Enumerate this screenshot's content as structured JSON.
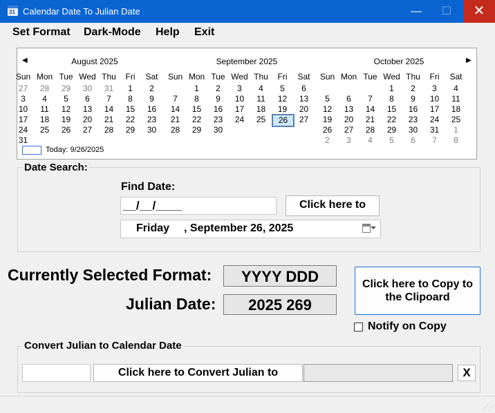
{
  "window": {
    "title": "Calendar Date To Julian Date",
    "minimize": "—",
    "maximize": "☐",
    "close": "✕"
  },
  "menu": [
    "Set Format",
    "Dark-Mode",
    "Help",
    "Exit"
  ],
  "calendar": {
    "prev": "◀",
    "next": "▶",
    "dow": [
      "Sun",
      "Mon",
      "Tue",
      "Wed",
      "Thu",
      "Fri",
      "Sat"
    ],
    "months": [
      {
        "title": "August 2025",
        "rows": [
          [
            [
              "27",
              1
            ],
            [
              "28",
              1
            ],
            [
              "29",
              1
            ],
            [
              "30",
              1
            ],
            [
              "31",
              1
            ],
            [
              "1",
              0
            ],
            [
              "2",
              0
            ]
          ],
          [
            [
              "3",
              0
            ],
            [
              "4",
              0
            ],
            [
              "5",
              0
            ],
            [
              "6",
              0
            ],
            [
              "7",
              0
            ],
            [
              "8",
              0
            ],
            [
              "9",
              0
            ]
          ],
          [
            [
              "10",
              0
            ],
            [
              "11",
              0
            ],
            [
              "12",
              0
            ],
            [
              "13",
              0
            ],
            [
              "14",
              0
            ],
            [
              "15",
              0
            ],
            [
              "16",
              0
            ]
          ],
          [
            [
              "17",
              0
            ],
            [
              "18",
              0
            ],
            [
              "19",
              0
            ],
            [
              "20",
              0
            ],
            [
              "21",
              0
            ],
            [
              "22",
              0
            ],
            [
              "23",
              0
            ]
          ],
          [
            [
              "24",
              0
            ],
            [
              "25",
              0
            ],
            [
              "26",
              0
            ],
            [
              "27",
              0
            ],
            [
              "28",
              0
            ],
            [
              "29",
              0
            ],
            [
              "30",
              0
            ]
          ],
          [
            [
              "31",
              0
            ],
            [
              "",
              0
            ],
            [
              "",
              0
            ],
            [
              "",
              0
            ],
            [
              "",
              0
            ],
            [
              "",
              0
            ],
            [
              "",
              0
            ]
          ]
        ]
      },
      {
        "title": "September 2025",
        "rows": [
          [
            [
              "",
              0
            ],
            [
              "1",
              0
            ],
            [
              "2",
              0
            ],
            [
              "3",
              0
            ],
            [
              "4",
              0
            ],
            [
              "5",
              0
            ],
            [
              "6",
              0
            ]
          ],
          [
            [
              "7",
              0
            ],
            [
              "8",
              0
            ],
            [
              "9",
              0
            ],
            [
              "10",
              0
            ],
            [
              "11",
              0
            ],
            [
              "12",
              0
            ],
            [
              "13",
              0
            ]
          ],
          [
            [
              "14",
              0
            ],
            [
              "15",
              0
            ],
            [
              "16",
              0
            ],
            [
              "17",
              0
            ],
            [
              "18",
              0
            ],
            [
              "19",
              0
            ],
            [
              "20",
              0
            ]
          ],
          [
            [
              "21",
              0
            ],
            [
              "22",
              0
            ],
            [
              "23",
              0
            ],
            [
              "24",
              0
            ],
            [
              "25",
              0
            ],
            [
              "26",
              2
            ],
            [
              "27",
              0
            ]
          ],
          [
            [
              "28",
              0
            ],
            [
              "29",
              0
            ],
            [
              "30",
              0
            ],
            [
              "",
              0
            ],
            [
              "",
              0
            ],
            [
              "",
              0
            ],
            [
              "",
              0
            ]
          ],
          [
            [
              "",
              0
            ],
            [
              "",
              0
            ],
            [
              "",
              0
            ],
            [
              "",
              0
            ],
            [
              "",
              0
            ],
            [
              "",
              0
            ],
            [
              "",
              0
            ]
          ]
        ]
      },
      {
        "title": "October 2025",
        "rows": [
          [
            [
              "",
              0
            ],
            [
              "",
              0
            ],
            [
              "",
              0
            ],
            [
              "1",
              0
            ],
            [
              "2",
              0
            ],
            [
              "3",
              0
            ],
            [
              "4",
              0
            ]
          ],
          [
            [
              "5",
              0
            ],
            [
              "6",
              0
            ],
            [
              "7",
              0
            ],
            [
              "8",
              0
            ],
            [
              "9",
              0
            ],
            [
              "10",
              0
            ],
            [
              "11",
              0
            ]
          ],
          [
            [
              "12",
              0
            ],
            [
              "13",
              0
            ],
            [
              "14",
              0
            ],
            [
              "15",
              0
            ],
            [
              "16",
              0
            ],
            [
              "17",
              0
            ],
            [
              "18",
              0
            ]
          ],
          [
            [
              "19",
              0
            ],
            [
              "20",
              0
            ],
            [
              "21",
              0
            ],
            [
              "22",
              0
            ],
            [
              "23",
              0
            ],
            [
              "24",
              0
            ],
            [
              "25",
              0
            ]
          ],
          [
            [
              "26",
              0
            ],
            [
              "27",
              0
            ],
            [
              "28",
              0
            ],
            [
              "29",
              0
            ],
            [
              "30",
              0
            ],
            [
              "31",
              0
            ],
            [
              "1",
              1
            ]
          ],
          [
            [
              "2",
              1
            ],
            [
              "3",
              1
            ],
            [
              "4",
              1
            ],
            [
              "5",
              1
            ],
            [
              "6",
              1
            ],
            [
              "7",
              1
            ],
            [
              "8",
              1
            ]
          ]
        ]
      }
    ],
    "today_label": "Today: 9/26/2025"
  },
  "date_search": {
    "group_label": "Date Search:",
    "find_label": "Find Date:",
    "mask": "__/__/____",
    "find_button": "Click here to",
    "picker_day": "Friday",
    "picker_date": ", September 26, 2025",
    "picker_icon": "calendar-dropdown-icon"
  },
  "format": {
    "label": "Currently Selected Format:",
    "value": "YYYY DDD",
    "julian_label": "Julian Date:",
    "julian_value": "2025 269",
    "copy_button": "Click here to Copy to the Clipoard",
    "notify_label": "Notify on Copy"
  },
  "convert": {
    "group_label": "Convert Julian to Calendar Date",
    "input_value": "",
    "convert_button": "Click here to Convert Julian to",
    "result_value": "",
    "clear_button": "X"
  }
}
